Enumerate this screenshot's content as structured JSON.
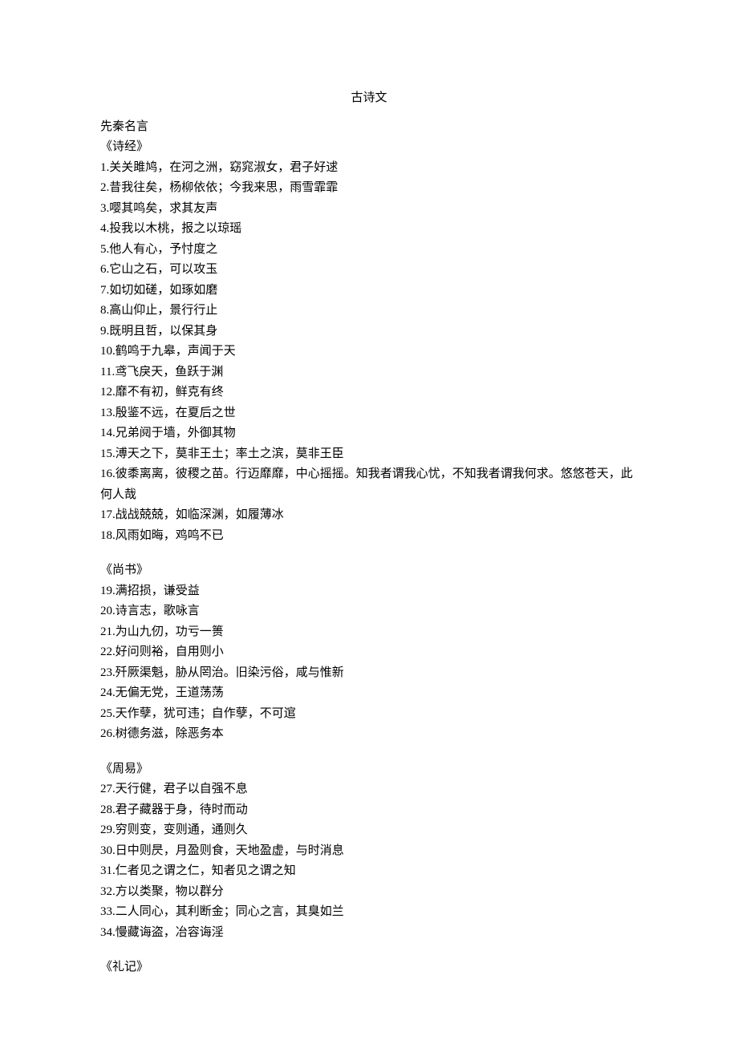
{
  "title": "古诗文",
  "heading_main": "先秦名言",
  "sections": [
    {
      "source": "《诗经》",
      "quotes": [
        "1.关关雎鸠，在河之洲，窈窕淑女，君子好逑",
        "2.昔我往矣，杨柳依依；今我来思，雨雪霏霏",
        "3.嘤其鸣矣，求其友声",
        "4.投我以木桃，报之以琼瑶",
        "5.他人有心，予忖度之",
        "6.它山之石，可以攻玉",
        "7.如切如磋，如琢如磨",
        "8.高山仰止，景行行止",
        "9.既明且哲，以保其身",
        "10.鹤鸣于九皋，声闻于天",
        "11.鸢飞戾天，鱼跃于渊",
        "12.靡不有初，鲜克有终",
        "13.殷鉴不远，在夏后之世",
        "14.兄弟阋于墙，外御其物",
        "15.溥天之下，莫非王土；率土之滨，莫非王臣",
        "16.彼黍离离，彼稷之苗。行迈靡靡，中心摇摇。知我者谓我心忧，不知我者谓我何求。悠悠苍天，此何人哉",
        "17.战战兢兢，如临深渊，如履薄冰",
        "18.风雨如晦，鸡鸣不已"
      ]
    },
    {
      "source": "《尚书》",
      "quotes": [
        "19.满招损，谦受益",
        "20.诗言志，歌咏言",
        "21.为山九仞，功亏一篑",
        "22.好问则裕，自用则小",
        "23.歼厥渠魁，胁从罔治。旧染污俗，咸与惟新",
        "24.无偏无党，王道荡荡",
        "25.天作孽，犹可违；自作孽，不可逭",
        "26.树德务滋，除恶务本"
      ]
    },
    {
      "source": "《周易》",
      "quotes": [
        "27.天行健，君子以自强不息",
        "28.君子藏器于身，待时而动",
        "29.穷则变，变则通，通则久",
        "30.日中则昃，月盈则食，天地盈虚，与时消息",
        "31.仁者见之谓之仁，知者见之谓之知",
        "32.方以类聚，物以群分",
        "33.二人同心，其利断金；同心之言，其臭如兰",
        "34.慢藏诲盗，冶容诲淫"
      ]
    },
    {
      "source": "《礼记》",
      "quotes": []
    }
  ]
}
